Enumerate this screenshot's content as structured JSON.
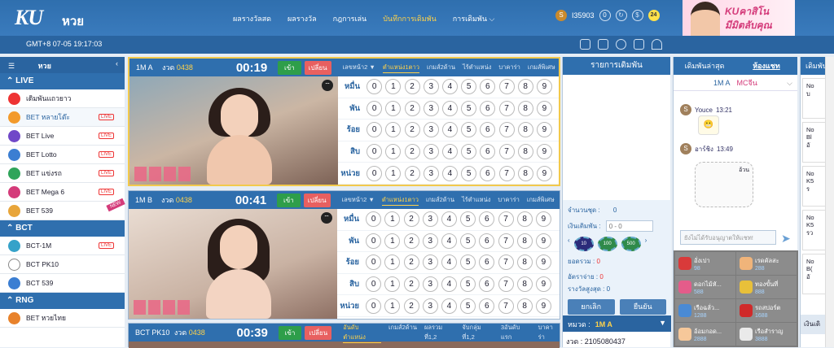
{
  "header": {
    "logo": "KU",
    "section": "หวย",
    "nav": [
      "ผลรางวัลสด",
      "ผลรางวัล",
      "กฎการเล่น",
      "บันทึกการเดิมพัน",
      "การเดิมพัน"
    ],
    "user_id": "I35903",
    "balance": "0",
    "vip_level": "24",
    "banner_line1": "KUคาสิโน",
    "banner_line2": "มีมิตลับคุณ"
  },
  "subbar": {
    "time": "GMT+8 07-05 19:17:03"
  },
  "sidebar": {
    "title": "หวย",
    "sections": [
      {
        "label": "LIVE",
        "items": [
          "เดิมพันแถวยาว",
          "BET หลายโต๊ะ",
          "BET Live",
          "BET Lotto",
          "BET แข่งรถ",
          "BET Mega 6",
          "BET 539"
        ]
      },
      {
        "label": "BCT",
        "items": [
          "BCT-1M",
          "BCT PK10",
          "BCT 539"
        ]
      },
      {
        "label": "RNG",
        "items": [
          "BET หวยไทย"
        ]
      }
    ],
    "live_badge": "LIVE",
    "new_badge": "NEW"
  },
  "games": [
    {
      "name": "1M A",
      "round_label": "งวด",
      "round": "0438",
      "timer": "00:19",
      "enter": "เข้า",
      "change": "เปลี่ยน",
      "tabs": [
        "เลขหน้า2 ▼",
        "ตำแหน่ง1ตาว",
        "เกมส์2ด้าน",
        "ไร้ตำแหน่ง",
        "บาคาร่า",
        "เกมส์พิเศษ"
      ],
      "selected_tab": 1,
      "rows": [
        "หมื่น",
        "พัน",
        "ร้อย",
        "สิบ",
        "หน่วย"
      ]
    },
    {
      "name": "1M B",
      "round_label": "งวด",
      "round": "0438",
      "timer": "00:41",
      "enter": "เข้า",
      "change": "เปลี่ยน",
      "tabs": [
        "เลขหน้า2 ▼",
        "ตำแหน่ง1ตาว",
        "เกมส์2ด้าน",
        "ไร้ตำแหน่ง",
        "บาคาร่า",
        "เกมส์พิเศษ"
      ],
      "selected_tab": 1,
      "rows": [
        "หมื่น",
        "พัน",
        "ร้อย",
        "สิบ",
        "หน่วย"
      ]
    },
    {
      "name": "BCT PK10",
      "round_label": "งวด",
      "round": "0438",
      "timer": "00:39",
      "enter": "เข้า",
      "change": "เปลี่ยน",
      "tabs": [
        "อันดับตำแหน่ง",
        "เกมส์2ด้าน",
        "ผลรวมที่1,2",
        "จับกลุ่มที่1,2",
        "3อันดับแรก",
        "บาคาร่า"
      ],
      "selected_tab": 0,
      "rows": []
    }
  ],
  "digits": [
    "0",
    "1",
    "2",
    "3",
    "4",
    "5",
    "6",
    "7",
    "8",
    "9"
  ],
  "record": {
    "title": "รายการเดิมพัน",
    "count_label": "จำนวนชุด :",
    "count": "0",
    "amount_label": "เงินเดิมพัน :",
    "amount_placeholder": "0 - 0",
    "chips": [
      "10",
      "100",
      "500"
    ],
    "total_label": "ยอดรวม :",
    "total": "0",
    "rate_label": "อัตราจ่าย :",
    "rate": "0",
    "max_label": "รางวัลสูงสุด :",
    "max": "0",
    "cancel": "ยกเลิก",
    "confirm": "ยืนยัน",
    "category_label": "หมวด :",
    "category": "1M A",
    "footer": "งวด : 2105080437"
  },
  "chat": {
    "tab_latest": "เดิมพันล่าสุด",
    "tab_chat": "ห้องแชท",
    "room": "1M A",
    "mc": "MCจีน",
    "messages": [
      {
        "user": "Youce",
        "time": "13:21"
      },
      {
        "user": "อาร์ชิง",
        "time": "13:49"
      }
    ],
    "sticker_text": "อ้วน",
    "input_placeholder": "ยังไม่ได้รับอนุญาตให้แชท!",
    "gifts": [
      {
        "name": "อั่งเปา",
        "price": "98"
      },
      {
        "name": "เรดคัลสะ",
        "price": "288"
      },
      {
        "name": "ดอกไม้หั...",
        "price": "588"
      },
      {
        "name": "ทองขั้นที่",
        "price": "888"
      },
      {
        "name": "เรือฉลั่ว...",
        "price": "1288"
      },
      {
        "name": "รถสปอร์ต",
        "price": "1688"
      },
      {
        "name": "อ้อมกอด...",
        "price": "2888"
      },
      {
        "name": "เรือสำราญ",
        "price": "3888"
      }
    ]
  },
  "right_panel": {
    "title": "เดิมพัน",
    "cards": [
      "No\nบ",
      "No\nBl\nอั",
      "No\nK5\nร",
      "No\nK5\nรว",
      "No\nB(\nอั"
    ],
    "footer": "เงินเดิ"
  }
}
